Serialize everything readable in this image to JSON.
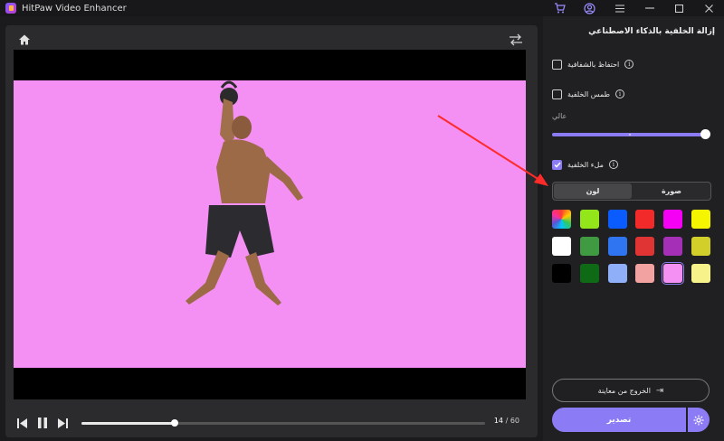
{
  "app": {
    "title": "HitPaw Video Enhancer"
  },
  "titlebar": {
    "icons": [
      "cart-icon",
      "account-icon",
      "menu-icon",
      "minimize-icon",
      "maximize-icon",
      "close-icon"
    ]
  },
  "preview": {
    "background_color": "#f48ff3",
    "playback": {
      "current_frame": "14",
      "total_frames": "60",
      "progress": 0.23
    }
  },
  "panel": {
    "title": "إزالة الخلفية بالذكاء الاصطناعي",
    "options": {
      "keep_transparency": {
        "label": "احتفاظ بالشفافية",
        "checked": false
      },
      "blur_background": {
        "label": "طمس الخلفية",
        "checked": false
      },
      "fill_background": {
        "label": "ملء الخلفية",
        "checked": true
      }
    },
    "blur_level": {
      "label": "عالي",
      "value": 1.0
    },
    "fill_tabs": [
      {
        "label": "لون",
        "active": true
      },
      {
        "label": "صورة",
        "active": false
      }
    ],
    "swatches": [
      {
        "color": "conic-gradient(#ff3b30,#ffcc00,#34c759,#00c7ff,#5856d6,#ff2d9a,#ff3b30)",
        "name": "color-picker"
      },
      {
        "color": "#92e61a"
      },
      {
        "color": "#0b5cff"
      },
      {
        "color": "#f22a2a"
      },
      {
        "color": "#f500f5"
      },
      {
        "color": "#f5f500"
      },
      {
        "color": "#ffffff"
      },
      {
        "color": "#3f9a42"
      },
      {
        "color": "#2f74f0"
      },
      {
        "color": "#e03333"
      },
      {
        "color": "#a52fb7"
      },
      {
        "color": "#d2cf2a"
      },
      {
        "color": "#000000"
      },
      {
        "color": "#0f6a16"
      },
      {
        "color": "#8fb0f8"
      },
      {
        "color": "#f3a2a2"
      },
      {
        "color": "#f48ff3",
        "selected": true
      },
      {
        "color": "#f7f38a"
      }
    ],
    "exit_preview_label": "الخروج من معاينة",
    "export_label": "تصدير"
  }
}
